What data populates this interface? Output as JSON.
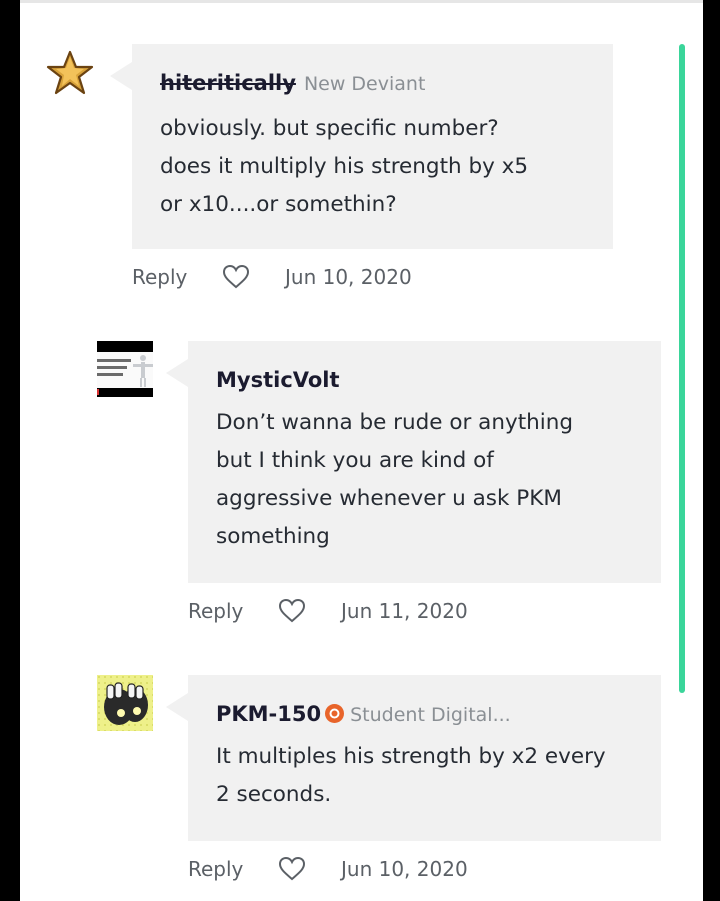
{
  "comments": [
    {
      "author": "hiteritically",
      "role": "New Deviant",
      "text_lines": [
        "obviously. but specific number?",
        "does it multiply his strength by x5",
        "or x10....or somethin?"
      ],
      "reply_label": "Reply",
      "date": "Jun 10, 2020",
      "avatar_icon": "gold-star-icon"
    },
    {
      "author": "MysticVolt",
      "role": "",
      "text_lines": [
        "Don’t wanna be rude or anything",
        "but I think you are kind of",
        "aggressive whenever u ask PKM",
        "something"
      ],
      "reply_label": "Reply",
      "date": "Jun 11, 2020",
      "avatar_icon": "video-thumbnail-avatar"
    },
    {
      "author": "PKM-150",
      "role": "Student Digital...",
      "text_lines": [
        "It multiples his strength by x2 every",
        "2 seconds."
      ],
      "reply_label": "Reply",
      "date": "Jun 10, 2020",
      "avatar_icon": "yellow-fists-avatar"
    }
  ],
  "colors": {
    "thread_bar": "#3ad59a",
    "bubble": "#f1f1f1",
    "badge": "#e8642a"
  }
}
